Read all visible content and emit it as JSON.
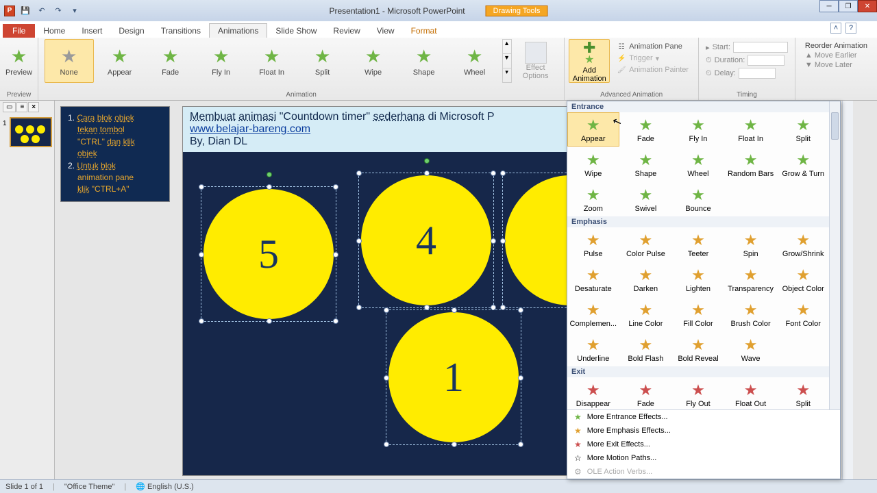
{
  "title": "Presentation1 - Microsoft PowerPoint",
  "contextual_group": "Drawing Tools",
  "ribbon_tabs": {
    "file": "File",
    "home": "Home",
    "insert": "Insert",
    "design": "Design",
    "transitions": "Transitions",
    "animations": "Animations",
    "slideshow": "Slide Show",
    "review": "Review",
    "view": "View",
    "format": "Format"
  },
  "ribbon": {
    "preview": "Preview",
    "preview_group": "Preview",
    "anim_group": "Animation",
    "adv_group": "Advanced Animation",
    "timing_group": "Timing",
    "effects": [
      "None",
      "Appear",
      "Fade",
      "Fly In",
      "Float In",
      "Split",
      "Wipe",
      "Shape",
      "Wheel"
    ],
    "effect_options": "Effect\nOptions",
    "add_animation": "Add\nAnimation",
    "animation_pane": "Animation Pane",
    "trigger": "Trigger",
    "animation_painter": "Animation Painter",
    "start_lbl": "Start:",
    "duration_lbl": "Duration:",
    "delay_lbl": "Delay:",
    "reorder": "Reorder Animation",
    "move_earlier": "Move Earlier",
    "move_later": "Move Later"
  },
  "notes": {
    "l1a": "Cara",
    "l1b": "blok",
    "l1c": "objek",
    "l2a": "tekan",
    "l2b": "tombol",
    "l3a": "\"CTRL\"",
    "l3b": "dan",
    "l3c": "klik",
    "l4": "objek",
    "l5a": "Untuk",
    "l5b": "blok",
    "l6": "animation pane",
    "l7a": "klik",
    "l7b": "\"CTRL+A\""
  },
  "slide": {
    "h1a": "Membuat",
    "h1b": "animasi",
    "h1c": "\"Countdown timer\"",
    "h1d": "sederhana",
    "h1e": "di Microsoft P",
    "link": "www.belajar-bareng.com",
    "by": "By, Dian DL",
    "c5": "5",
    "c4": "4",
    "c1": "1"
  },
  "gallery": {
    "cat_entrance": "Entrance",
    "cat_emphasis": "Emphasis",
    "cat_exit": "Exit",
    "entrance": [
      "Appear",
      "Fade",
      "Fly In",
      "Float In",
      "Split",
      "Wipe",
      "Shape",
      "Wheel",
      "Random Bars",
      "Grow & Turn",
      "Zoom",
      "Swivel",
      "Bounce"
    ],
    "emphasis": [
      "Pulse",
      "Color Pulse",
      "Teeter",
      "Spin",
      "Grow/Shrink",
      "Desaturate",
      "Darken",
      "Lighten",
      "Transparency",
      "Object Color",
      "Complemen...",
      "Line Color",
      "Fill Color",
      "Brush Color",
      "Font Color",
      "Underline",
      "Bold Flash",
      "Bold Reveal",
      "Wave"
    ],
    "exit": [
      "Disappear",
      "Fade",
      "Fly Out",
      "Float Out",
      "Split"
    ],
    "more_entrance": "More Entrance Effects...",
    "more_emphasis": "More Emphasis Effects...",
    "more_exit": "More Exit Effects...",
    "more_motion": "More Motion Paths...",
    "ole": "OLE Action Verbs..."
  },
  "status": {
    "slide": "Slide 1 of 1",
    "theme": "\"Office Theme\"",
    "lang": "English (U.S.)"
  }
}
